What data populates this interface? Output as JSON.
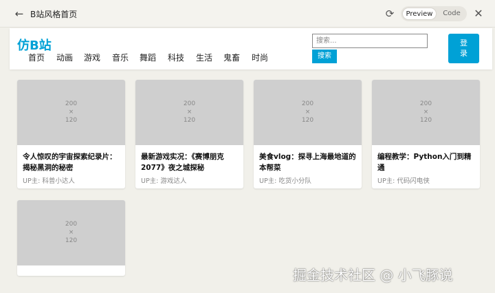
{
  "window": {
    "back_icon": "arrow-left-icon",
    "title": "B站风格首页",
    "refresh_icon": "refresh-icon",
    "view_toggle": {
      "preview": "Preview",
      "code": "Code",
      "selected": "Preview"
    },
    "close_icon": "close-icon"
  },
  "header": {
    "logo": "仿B站",
    "nav": [
      "首页",
      "动画",
      "游戏",
      "音乐",
      "舞蹈",
      "科技",
      "生活",
      "鬼畜",
      "时尚"
    ],
    "search": {
      "placeholder": "搜索...",
      "button": "搜索"
    },
    "login": "登\n录",
    "accent": "#00a1d6"
  },
  "videos": [
    {
      "thumb_line1": "200",
      "thumb_line2": "×",
      "thumb_line3": "120",
      "title": "令人惊叹的宇宙探索纪录片：揭秘黑洞的秘密",
      "up": "UP主: 科普小达人"
    },
    {
      "thumb_line1": "200",
      "thumb_line2": "×",
      "thumb_line3": "120",
      "title": "最新游戏实况：《赛博朋克2077》夜之城探秘",
      "up": "UP主: 游戏达人"
    },
    {
      "thumb_line1": "200",
      "thumb_line2": "×",
      "thumb_line3": "120",
      "title": "美食vlog：探寻上海最地道的本帮菜",
      "up": "UP主: 吃货小分队"
    },
    {
      "thumb_line1": "200",
      "thumb_line2": "×",
      "thumb_line3": "120",
      "title": "编程教学：Python入门到精通",
      "up": "UP主: 代码闪电侠"
    },
    {
      "thumb_line1": "200",
      "thumb_line2": "×",
      "thumb_line3": "120",
      "title": "",
      "up": ""
    }
  ],
  "watermark": "掘金技术社区 @ 小飞豚说"
}
